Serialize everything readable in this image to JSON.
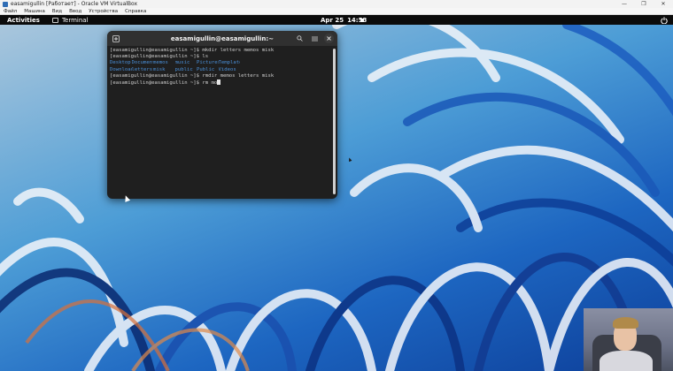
{
  "host_window": {
    "title": "easamigullin [Работает] - Oracle VM VirtualBox",
    "controls": [
      "—",
      "❐",
      "✕"
    ],
    "menu": [
      "Файл",
      "Машина",
      "Вид",
      "Ввод",
      "Устройства",
      "Справка"
    ]
  },
  "gnome_bar": {
    "activities": "Activities",
    "app_name": "Terminal",
    "date": "Apr 25",
    "time": "14:53"
  },
  "terminal": {
    "title": "easamigullin@easamigullin:~",
    "lines": [
      "[easamigullin@easamigullin ~]$ mkdir letters memos misk",
      "[easamigullin@easamigullin ~]$ ls"
    ],
    "ls_rows": [
      [
        "Desktop",
        "Documents",
        "memos",
        "music",
        "Pictures",
        "Templates"
      ],
      [
        "Downloads",
        "letters",
        "misk",
        "public",
        "Public",
        "Videos"
      ]
    ],
    "after_lines": [
      "[easamigullin@easamigullin ~]$ rmdir memos letters misk"
    ],
    "prompt": "[easamigullin@easamigullin ~]$ ",
    "current_input": "rm mo"
  },
  "colors": {
    "dir_blue": "#4a8fd8",
    "terminal_bg": "#1f1f1f",
    "header_bg": "#303030"
  }
}
